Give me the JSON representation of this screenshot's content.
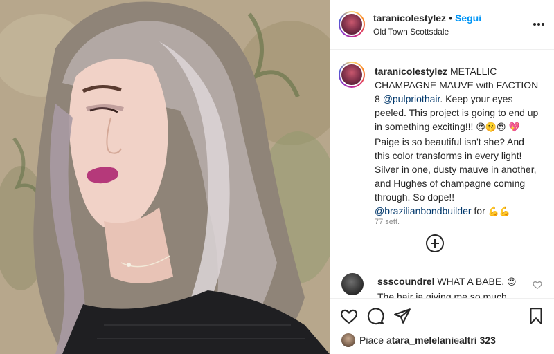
{
  "header": {
    "username": "taranicolestylez",
    "separator": "•",
    "follow_label": "Segui",
    "location": "Old Town Scottsdale",
    "more_icon": "more-horizontal-icon"
  },
  "caption": {
    "username": "taranicolestylez",
    "parts": [
      " METALLIC CHAMPAGNE MAUVE with FACTION 8 ",
      "@pulpriothair",
      ". Keep your eyes peeled. This project is going to end up in something exciting!!! ",
      "😍🤫😍",
      " ",
      "💖",
      " Paige is so beautiful isn't she? And this color transforms in every light! Silver in one, dusty mauve in another, and Hughes of champagne coming through. So dope!! ",
      "@brazilianbondbuilder",
      " for ",
      "💪💪"
    ],
    "timestamp": "77 sett."
  },
  "comment": {
    "username": "ssscoundrel",
    "text": " WHAT A BABE. ",
    "emoji": "😍",
    "continuation": "The hair ia giving me so much"
  },
  "actions": {
    "like_icon": "heart-icon",
    "comment_icon": "comment-icon",
    "share_icon": "share-icon",
    "save_icon": "bookmark-icon"
  },
  "likes": {
    "prefix": "Piace a ",
    "user": "tara_melelani",
    "middle": " e ",
    "others": "altri 323"
  },
  "colors": {
    "accent": "#0095f6",
    "mention": "#00376b",
    "text": "#262626",
    "muted": "#8e8e8e",
    "border": "#efefef"
  }
}
